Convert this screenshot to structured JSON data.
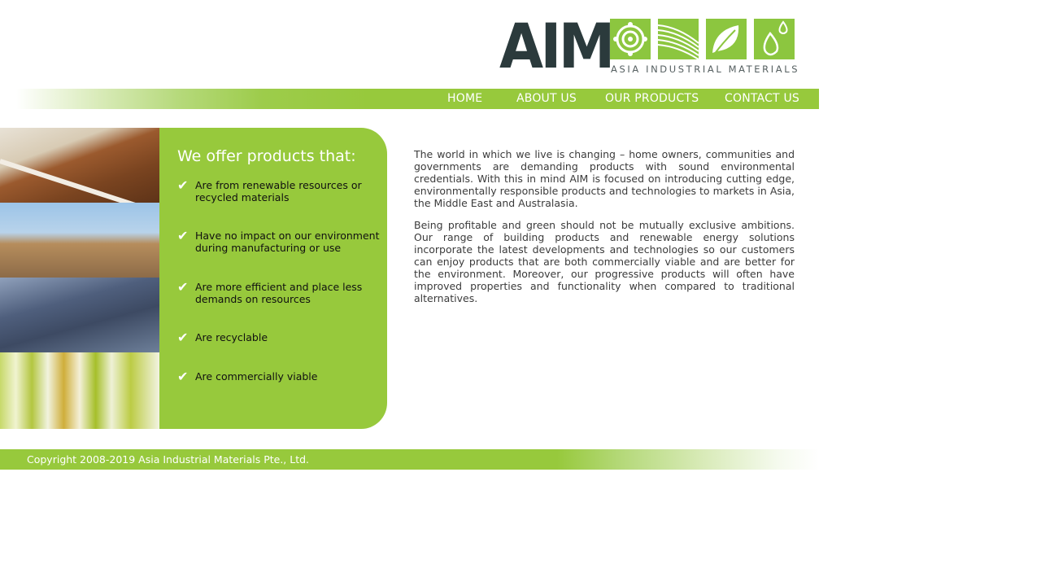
{
  "brand": {
    "logo_text": "AIM",
    "tagline": "ASIA INDUSTRIAL MATERIALS",
    "tile_icons": [
      "flower-icon",
      "waves-icon",
      "leaf-icon",
      "droplets-icon"
    ],
    "green": "#8cc63f",
    "dark": "#2b3a3c"
  },
  "nav": {
    "items": [
      "HOME",
      "ABOUT US",
      "OUR PRODUCTS",
      "CONTACT US"
    ]
  },
  "offer": {
    "title": "We offer products that:",
    "items": [
      "Are from renewable resources or recycled materials",
      "Have no impact on our environment during manufacturing or use",
      "Are more efficient and place less demands on resources",
      "Are recyclable",
      "Are commercially viable"
    ]
  },
  "content": {
    "paragraphs": [
      "The world in which we live is changing – home owners, communities and governments are demanding products with sound environmental credentials. With this in mind AIM is focused on introducing cutting edge, environmentally responsible products and technologies to markets in Asia, the Middle East and Australasia.",
      "Being profitable and green should not be mutually exclusive ambitions. Our range of building products and renewable energy solutions incorporate the latest developments and technologies so our customers can enjoy products that are both commercially viable and are better for the environment. Moreover, our progressive products will often have improved properties and functionality when compared to traditional alternatives."
    ]
  },
  "footer": {
    "copyright": "Copyright 2008-2019 Asia Industrial Materials Pte., Ltd."
  }
}
